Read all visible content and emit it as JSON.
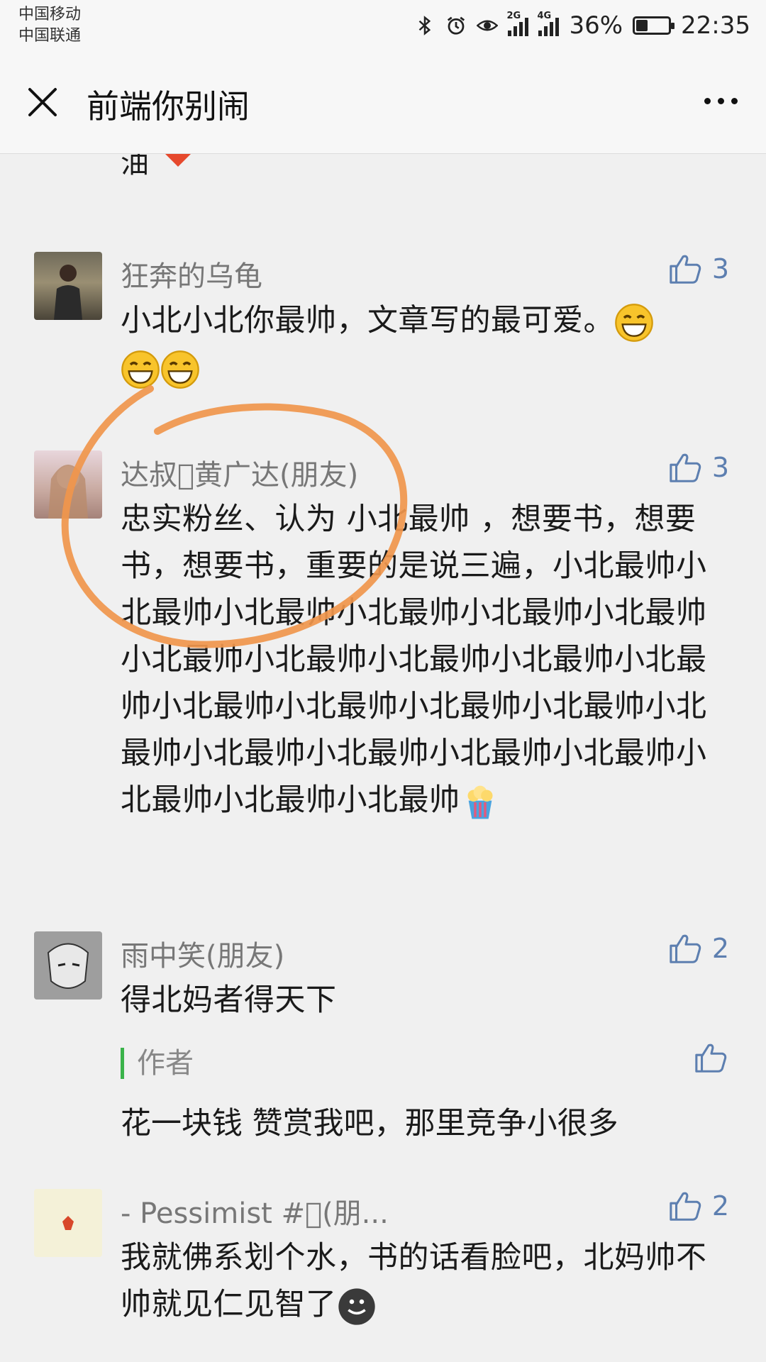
{
  "status_bar": {
    "carrier_1": "中国移动",
    "carrier_2": "中国联通",
    "net_1": "2G",
    "net_2": "4G",
    "battery_percent": "36%",
    "battery_level": 0.36,
    "time": "22:35"
  },
  "nav": {
    "title": "前端你别闹"
  },
  "snippet": {
    "text": "油"
  },
  "comments": [
    {
      "name": "狂奔的乌龟",
      "likes": "3",
      "text": "小北小北你最帅，文章写的最可爱。"
    },
    {
      "name": "达叔\u0000黄广达(朋友)",
      "likes": "3",
      "text": "忠实粉丝、认为 小北最帅 ，想要书，想要书，想要书，重要的是说三遍，小北最帅小北最帅小北最帅小北最帅小北最帅小北最帅小北最帅小北最帅小北最帅小北最帅小北最帅小北最帅小北最帅小北最帅小北最帅小北最帅小北最帅小北最帅小北最帅小北最帅小北最帅小北最帅小北最帅"
    },
    {
      "name": "雨中笑(朋友)",
      "likes": "2",
      "text": "得北妈者得天下",
      "reply": {
        "label": "作者",
        "text": "花一块钱 赞赏我吧，那里竞争小很多"
      }
    },
    {
      "name": "- Pessimist #\u0000(朋...",
      "likes": "2",
      "text": "我就佛系划个水，书的话看脸吧，北妈帅不帅就见仁见智了"
    }
  ],
  "colors": {
    "like_blue": "#5d7fb0",
    "annotation_orange": "#f0964c",
    "author_green": "#3ab34a"
  }
}
